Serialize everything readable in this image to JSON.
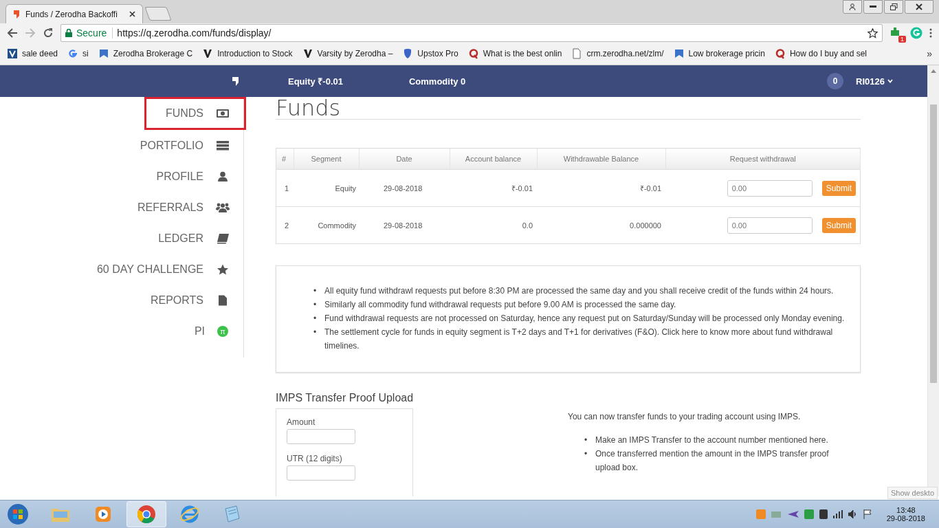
{
  "browser": {
    "tabs": [
      {
        "title": "Funds / Zerodha Backoffi",
        "selected": true
      }
    ],
    "secure_label": "Secure",
    "url": "https://q.zerodha.com/funds/display/",
    "extension_badge": "1",
    "bookmarks": [
      {
        "label": "sale deed",
        "kind": "square"
      },
      {
        "label": "si",
        "kind": "google"
      },
      {
        "label": "Zerodha Brokerage C",
        "kind": "doc"
      },
      {
        "label": "Introduction to Stock",
        "kind": "varsity"
      },
      {
        "label": "Varsity by Zerodha –",
        "kind": "varsity"
      },
      {
        "label": "Upstox Pro",
        "kind": "shield"
      },
      {
        "label": "What is the best onlin",
        "kind": "quora"
      },
      {
        "label": "crm.zerodha.net/zlm/",
        "kind": "page"
      },
      {
        "label": "Low brokerage pricin",
        "kind": "doc"
      },
      {
        "label": "How do I buy and sel",
        "kind": "quora"
      }
    ],
    "more_bookmarks": "»"
  },
  "navbar": {
    "equity": "Equity ₹-0.01",
    "commodity": "Commodity 0",
    "notifications": "0",
    "user": "RI0126"
  },
  "sidebar": {
    "items": [
      {
        "label": "FUNDS",
        "kind": "money",
        "selected": true
      },
      {
        "label": "PORTFOLIO",
        "kind": "list",
        "selected": false
      },
      {
        "label": "PROFILE",
        "kind": "user",
        "selected": false
      },
      {
        "label": "REFERRALS",
        "kind": "users",
        "selected": false
      },
      {
        "label": "LEDGER",
        "kind": "book",
        "selected": false
      },
      {
        "label": "60 DAY CHALLENGE",
        "kind": "star",
        "selected": false
      },
      {
        "label": "REPORTS",
        "kind": "file",
        "selected": false
      },
      {
        "label": "PI",
        "kind": "badge",
        "badge": "π",
        "selected": false
      }
    ]
  },
  "page_title": "Funds",
  "table": {
    "columns": [
      "#",
      "Segment",
      "Date",
      "Account balance",
      "Withdrawable Balance",
      "Request withdrawal"
    ],
    "rows": [
      {
        "number": "1",
        "segment": "Equity",
        "date": "29-08-2018",
        "account_balance": "₹-0.01",
        "withdrawable_balance": "₹-0.01",
        "placeholder": "0.00",
        "button": "Submit"
      },
      {
        "number": "2",
        "segment": "Commodity",
        "date": "29-08-2018",
        "account_balance": "0.0",
        "withdrawable_balance": "0.000000",
        "placeholder": "0.00",
        "button": "Submit"
      }
    ]
  },
  "bullet": "•",
  "notes": [
    "All equity fund withdrawl requests put before 8:30 PM are processed the same day and you shall receive credit of the funds within 24 hours.",
    "Similarly all commodity fund withdrawal requests put before 9.00 AM is processed the same day.",
    "Fund withdrawal requests are not processed on Saturday, hence any request put on Saturday/Sunday will be processed only Monday evening.",
    "The settlement cycle for funds in equity segment is T+2 days and T+1 for derivatives (F&O). Click here to know more about fund withdrawal timelines."
  ],
  "imps": {
    "title": "IMPS Transfer Proof Upload",
    "fields": [
      {
        "label": "Amount"
      },
      {
        "label": "UTR (12 digits)"
      }
    ],
    "intro": "You can now transfer funds to your trading account using IMPS.",
    "steps": [
      "Make an IMPS Transfer to the account number mentioned here.",
      "Once transferred mention the amount in the IMPS transfer proof upload box."
    ]
  },
  "tooltip": "Show deskto",
  "taskbar": {
    "apps": [
      {
        "kind": "folder",
        "active": false
      },
      {
        "kind": "media",
        "active": false
      },
      {
        "kind": "chrome",
        "active": true
      },
      {
        "kind": "ie",
        "active": false
      },
      {
        "kind": "notepad",
        "active": false
      }
    ],
    "time": "13:48",
    "date": "29-08-2018"
  }
}
